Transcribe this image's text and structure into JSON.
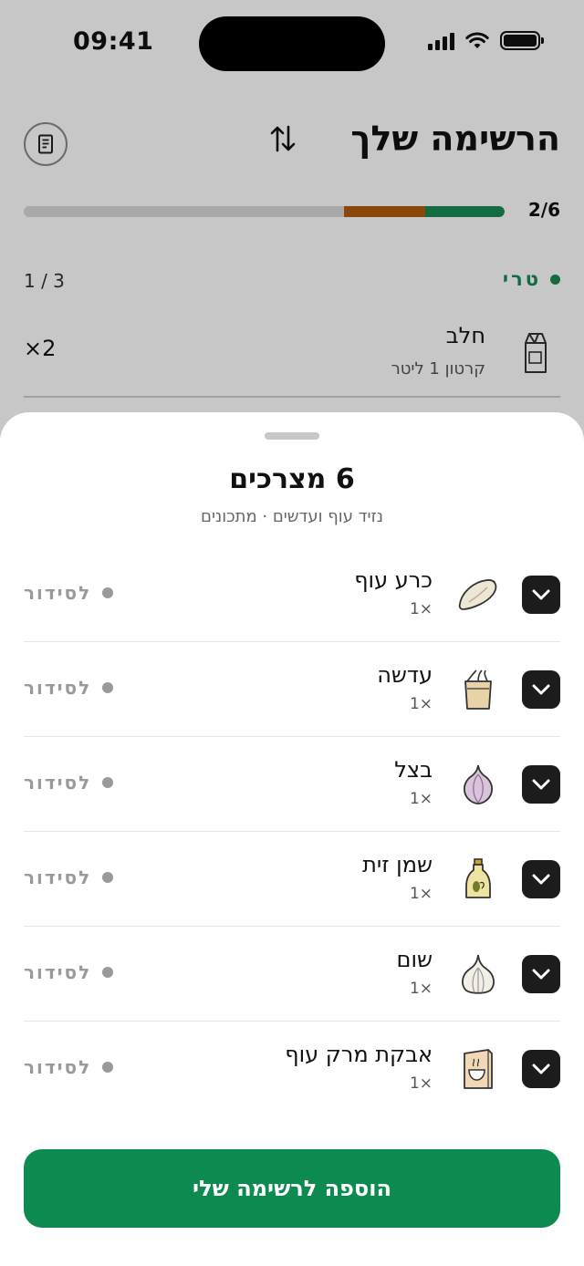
{
  "status_bar": {
    "time": "09:41"
  },
  "page": {
    "title": "הרשימה שלך",
    "progress": {
      "count": "2/6",
      "done_fraction_green": 0.17,
      "done_fraction_orange": 0.17
    },
    "section": {
      "label": "טרי",
      "page_indicator": "1 / 3"
    },
    "item": {
      "name": "חלב",
      "detail": "קרטון 1 ליטר",
      "qty": "×2"
    }
  },
  "sheet": {
    "title": "6 מצרכים",
    "subtitle": "נזיד עוף ועדשים · מתכונים",
    "status_label": "לסידור",
    "items": [
      {
        "name": "כרע עוף",
        "qty": "1×",
        "icon": "chicken-leg-icon"
      },
      {
        "name": "עדשה",
        "qty": "1×",
        "icon": "lentil-bag-icon"
      },
      {
        "name": "בצל",
        "qty": "1×",
        "icon": "onion-icon"
      },
      {
        "name": "שמן זית",
        "qty": "1×",
        "icon": "olive-oil-icon"
      },
      {
        "name": "שום",
        "qty": "1×",
        "icon": "garlic-icon"
      },
      {
        "name": "אבקת מרק עוף",
        "qty": "1×",
        "icon": "soup-powder-icon"
      }
    ],
    "add_button": "הוספה לרשימה שלי"
  },
  "colors": {
    "brand_green": "#0d8a50",
    "progress_orange": "#b25b0a",
    "progress_green": "#1a8a55"
  }
}
